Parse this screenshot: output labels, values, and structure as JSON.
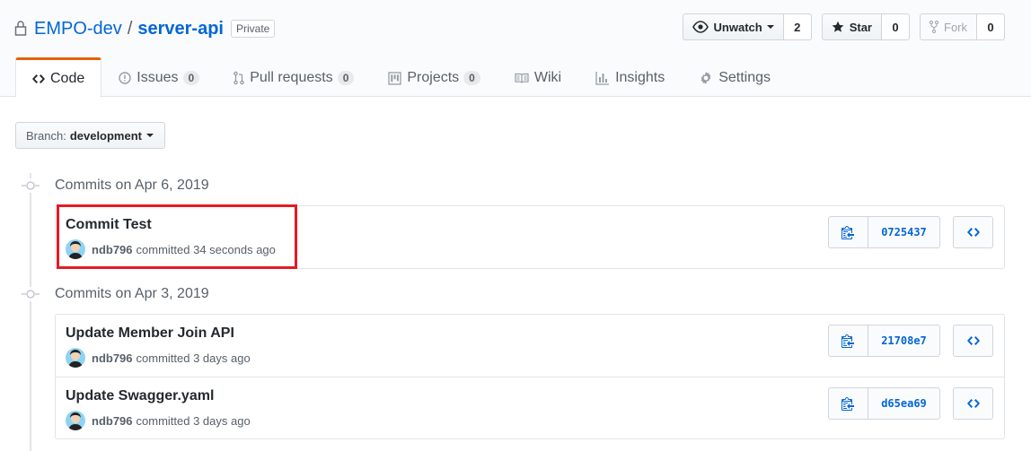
{
  "repo": {
    "owner": "EMPO-dev",
    "separator": "/",
    "name": "server-api",
    "visibility": "Private"
  },
  "actions": {
    "watch": {
      "label": "Unwatch",
      "count": "2"
    },
    "star": {
      "label": "Star",
      "count": "0"
    },
    "fork": {
      "label": "Fork",
      "count": "0"
    }
  },
  "tabs": [
    {
      "label": "Code",
      "icon": "code-icon",
      "selected": true
    },
    {
      "label": "Issues",
      "count": "0",
      "icon": "issue-icon"
    },
    {
      "label": "Pull requests",
      "count": "0",
      "icon": "pull-request-icon"
    },
    {
      "label": "Projects",
      "count": "0",
      "icon": "project-icon"
    },
    {
      "label": "Wiki",
      "icon": "book-icon"
    },
    {
      "label": "Insights",
      "icon": "graph-icon"
    },
    {
      "label": "Settings",
      "icon": "gear-icon"
    }
  ],
  "branch": {
    "prefix": "Branch:",
    "name": "development"
  },
  "groups": [
    {
      "heading": "Commits on Apr 6, 2019",
      "commits": [
        {
          "title": "Commit Test",
          "author": "ndb796",
          "meta": "committed 34 seconds ago",
          "sha": "0725437"
        }
      ]
    },
    {
      "heading": "Commits on Apr 3, 2019",
      "commits": [
        {
          "title": "Update Member Join API",
          "author": "ndb796",
          "meta": "committed 3 days ago",
          "sha": "21708e7"
        },
        {
          "title": "Update Swagger.yaml",
          "author": "ndb796",
          "meta": "committed 3 days ago",
          "sha": "d65ea69"
        }
      ]
    }
  ],
  "colors": {
    "accent_tab": "#e36209",
    "link": "#0366d6",
    "highlight": "#e31b23"
  }
}
